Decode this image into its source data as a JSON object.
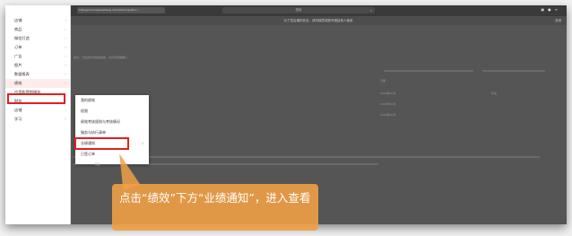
{
  "topbar": {
    "url": "shengsmm.taqiaoshaop.com/admin/public/...",
    "search_placeholder": "搜索",
    "notice": "为了您店铺的安全，请勿随意将账号借给他人使用",
    "notice_right": "关闭"
  },
  "sidebar": {
    "items": [
      {
        "label": "店铺"
      },
      {
        "label": "商品"
      },
      {
        "label": "微信打造"
      },
      {
        "label": "订单"
      },
      {
        "label": "广告"
      },
      {
        "label": "图片"
      },
      {
        "label": "数据报表"
      },
      {
        "label": "绩效"
      },
      {
        "label": "应用和营销服务"
      },
      {
        "label": "财务"
      },
      {
        "label": "店铺"
      },
      {
        "label": "学习"
      }
    ]
  },
  "dropdown": {
    "items": [
      {
        "label": "我的绩效"
      },
      {
        "label": "权限"
      },
      {
        "label": "绩效考核规则与考核情况"
      },
      {
        "label": "服务与执行清单"
      },
      {
        "label": "业绩通知"
      },
      {
        "label": "已签订单"
      }
    ]
  },
  "background": {
    "line1": "您好，已生成本月绩效报告，请及时查看确认",
    "col1": "日期",
    "col2": "状态",
    "val": "2024年01月"
  },
  "callout": {
    "text": "点击“绩效”下方“业绩通知”，进入查看"
  },
  "help": {
    "label": "帮助"
  }
}
